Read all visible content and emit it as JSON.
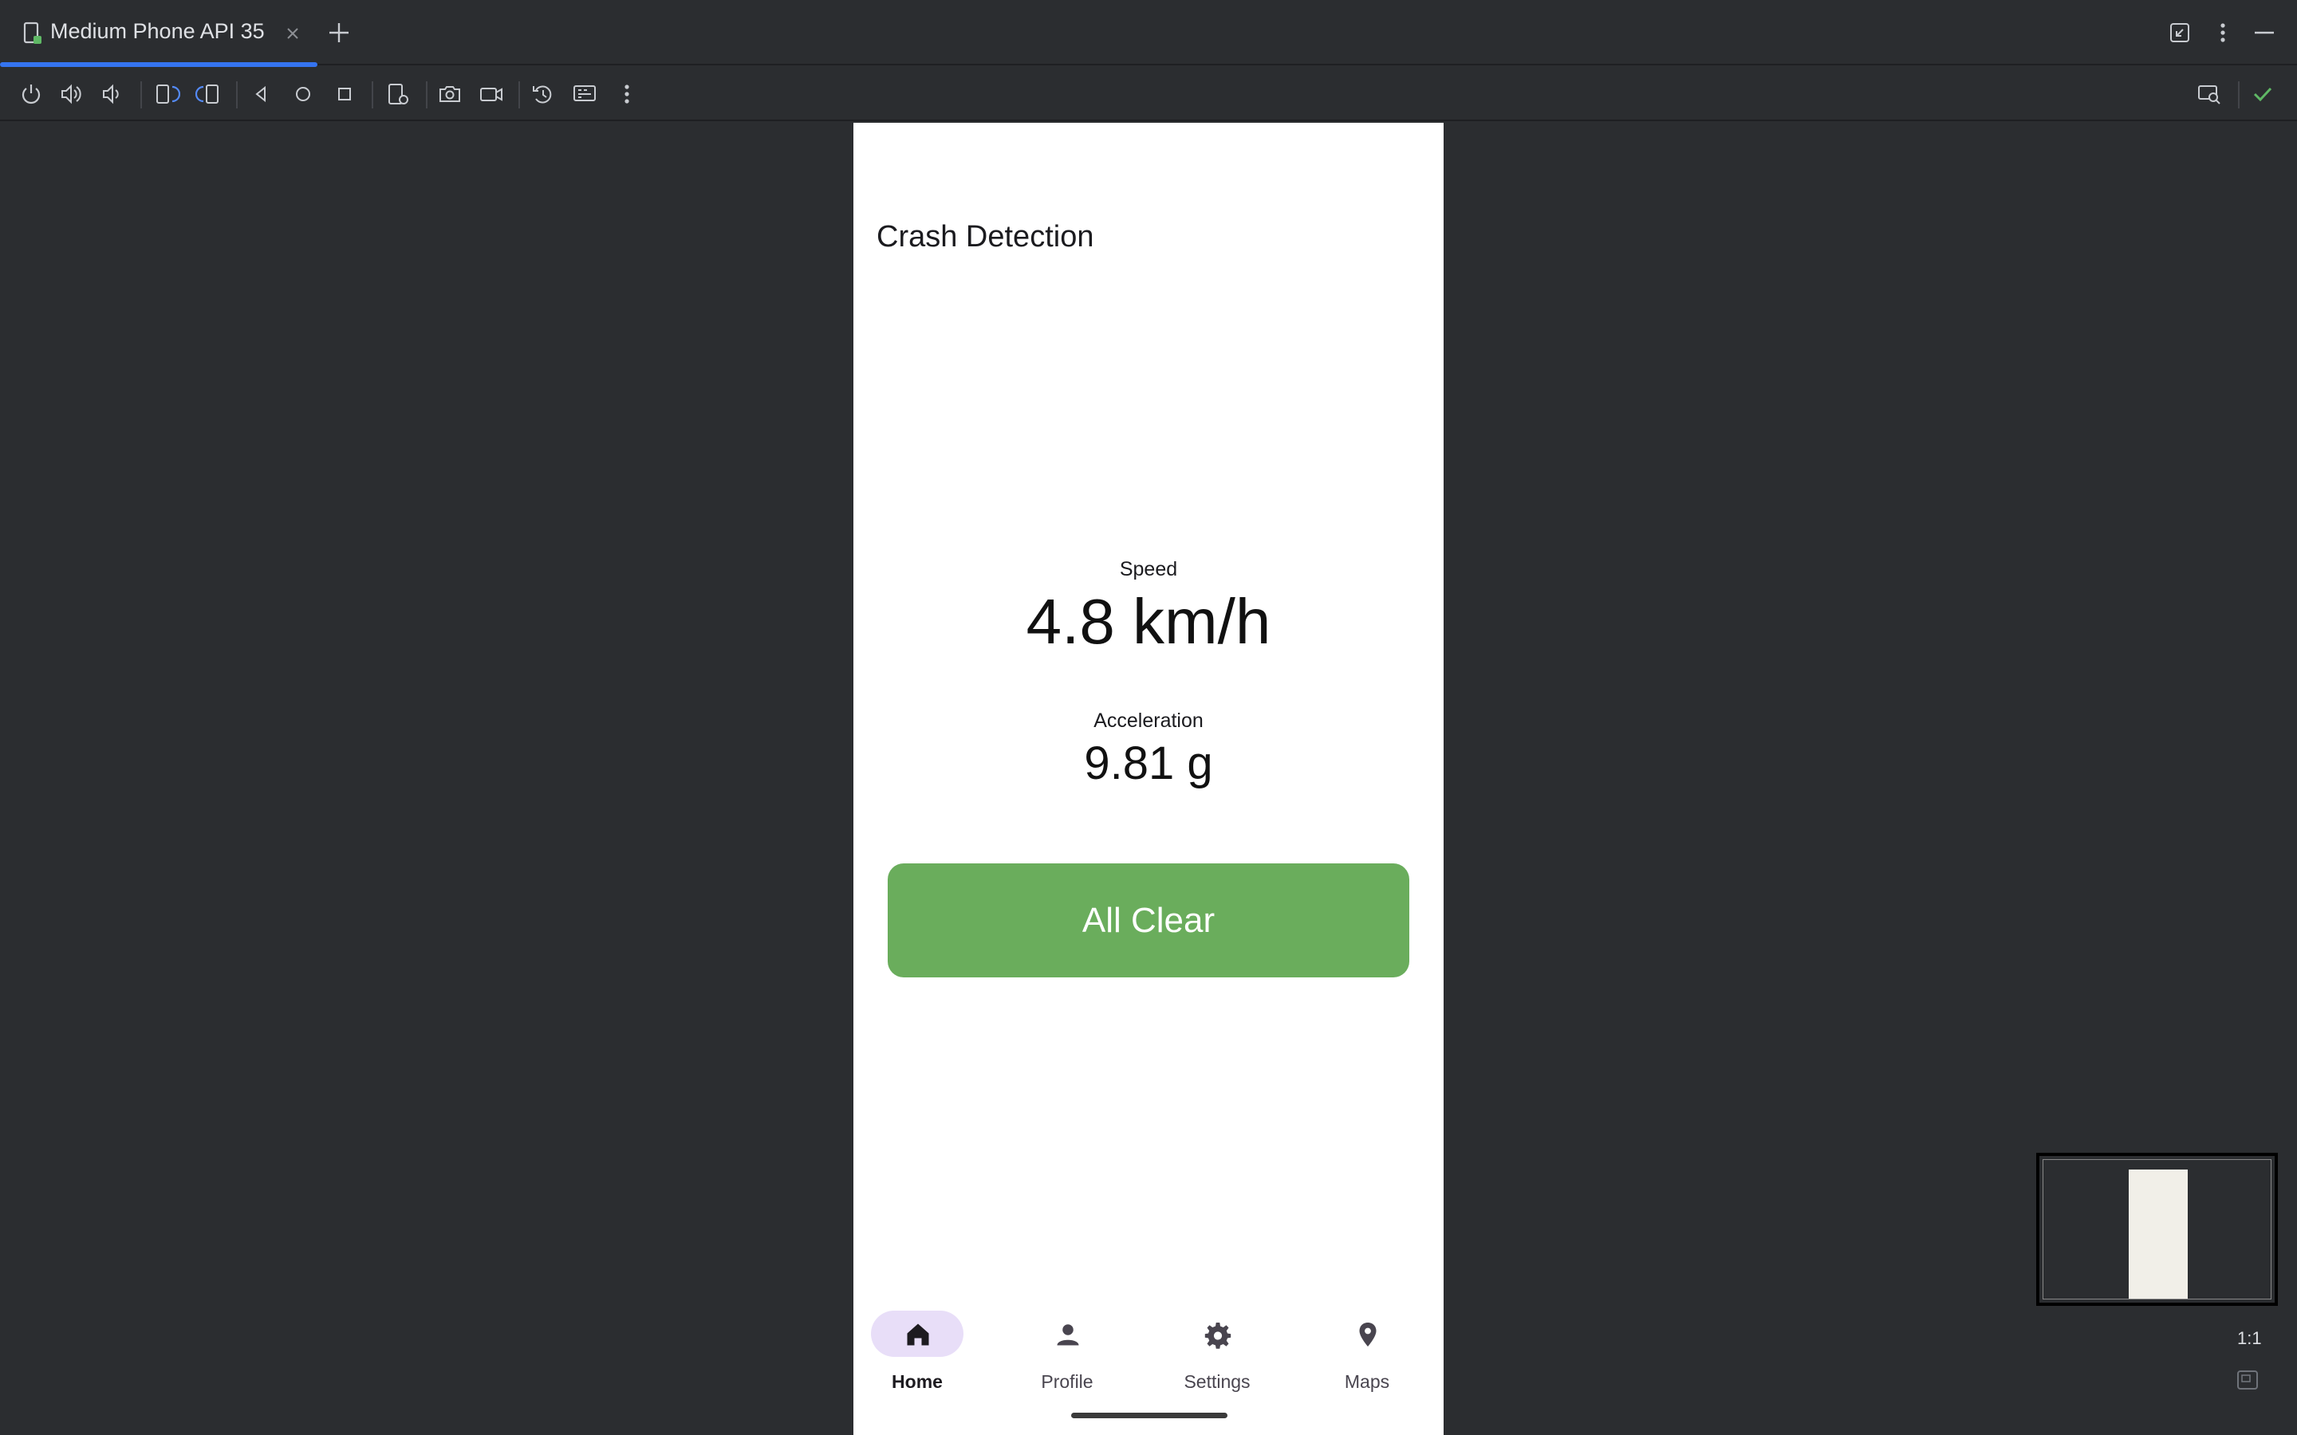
{
  "tab": {
    "title": "Medium Phone API 35"
  },
  "toolbar": {
    "buttons": [
      "power",
      "volume-up",
      "volume-down",
      "rotate-left",
      "rotate-right",
      "back",
      "home",
      "overview",
      "snapshots",
      "screenshot",
      "screen-record",
      "rewind",
      "extended-controls",
      "more"
    ]
  },
  "app": {
    "title": "Crash Detection",
    "speed": {
      "label": "Speed",
      "value": "4.8 km/h"
    },
    "acceleration": {
      "label": "Acceleration",
      "value": "9.81 g"
    },
    "status_button": "All Clear",
    "nav": [
      {
        "label": "Home",
        "icon": "home-icon",
        "active": true
      },
      {
        "label": "Profile",
        "icon": "person-icon",
        "active": false
      },
      {
        "label": "Settings",
        "icon": "gear-icon",
        "active": false
      },
      {
        "label": "Maps",
        "icon": "location-pin-icon",
        "active": false
      }
    ]
  },
  "zoom": {
    "label": "1:1"
  },
  "colors": {
    "ide_bg": "#2b2d30",
    "accent": "#3574f0",
    "status_ok": "#6aad5c",
    "nav_active_pill": "#e8def8",
    "check_green": "#5fb865"
  }
}
